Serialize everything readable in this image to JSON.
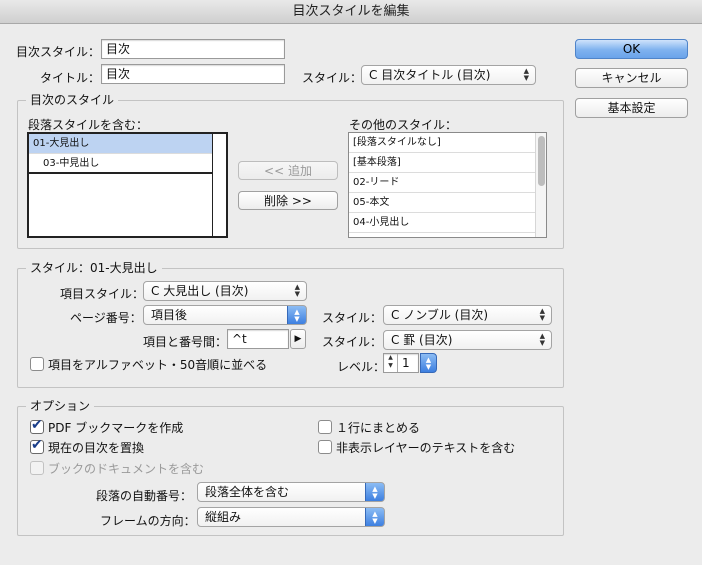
{
  "window": {
    "title": "目次スタイルを編集"
  },
  "main": {
    "toc_style_label": "目次スタイル：",
    "toc_style_value": "目次",
    "title_label": "タイトル：",
    "title_value": "目次",
    "style_label": "スタイル：",
    "title_style_value": "C 目次タイトル (目次)"
  },
  "buttons": {
    "ok": "OK",
    "cancel": "キャンセル",
    "basic_settings": "基本設定"
  },
  "toc_styles": {
    "title": "目次のスタイル",
    "include_label": "段落スタイルを含む：",
    "included": [
      "01-大見出し",
      "03-中見出し"
    ],
    "add_button": "<< 追加",
    "remove_button": "削除 >>",
    "other_label": "その他のスタイル：",
    "others": [
      "[段落スタイルなし]",
      "[基本段落]",
      "02-リード",
      "05-本文",
      "04-小見出し"
    ]
  },
  "style_section": {
    "title": "スタイル：01-大見出し",
    "entry_style_label": "項目スタイル：",
    "entry_style_value": "C 大見出し (目次)",
    "page_number_label": "ページ番号：",
    "page_number_value": "項目後",
    "page_style_label": "スタイル：",
    "page_style_value": "C ノンブル (目次)",
    "between_label": "項目と番号間：",
    "between_value": "^t",
    "between_style_label": "スタイル：",
    "between_style_value": "C 罫 (目次)",
    "sort_label": "項目をアルファベット・50音順に並べる",
    "sort_checked": false,
    "level_label": "レベル：",
    "level_value": "1"
  },
  "options": {
    "title": "オプション",
    "pdf_bookmarks": "PDF ブックマークを作成",
    "pdf_bookmarks_checked": true,
    "replace_existing": "現在の目次を置換",
    "replace_existing_checked": true,
    "include_book": "ブックのドキュメントを含む",
    "include_book_checked": false,
    "run_in": "１行にまとめる",
    "run_in_checked": false,
    "hidden_layers": "非表示レイヤーのテキストを含む",
    "hidden_layers_checked": false,
    "numbered_label": "段落の自動番号：",
    "numbered_value": "段落全体を含む",
    "frame_direction_label": "フレームの方向：",
    "frame_direction_value": "縦組み"
  },
  "icons": {
    "updown": "↕ popup-arrows-icon",
    "check": "checkmark-icon",
    "right_triangle": "triangle-right-icon"
  },
  "colors": {
    "accent": "#6aa3ea",
    "selection": "#bdd3f2",
    "checkmark": "#1b3e8a"
  }
}
